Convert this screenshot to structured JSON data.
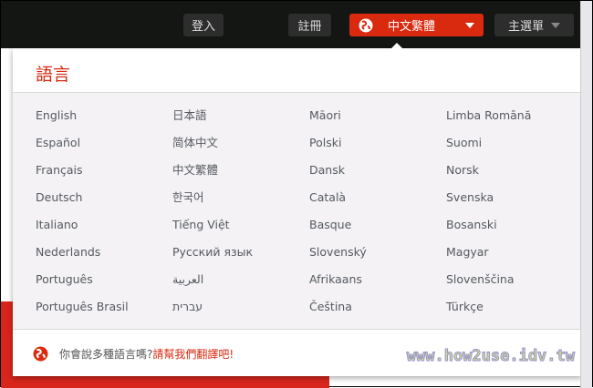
{
  "topbar": {
    "login": "登入",
    "register": "註冊",
    "language": "中文繁體",
    "menu": "主選單"
  },
  "panel": {
    "title": "語言",
    "columns": [
      [
        "English",
        "Español",
        "Français",
        "Deutsch",
        "Italiano",
        "Nederlands",
        "Português",
        "Português Brasil"
      ],
      [
        "日本語",
        "简体中文",
        "中文繁體",
        "한국어",
        "Tiếng Việt",
        "Русский язык",
        "العربية",
        "עברית"
      ],
      [
        "Māori",
        "Polski",
        "Dansk",
        "Català",
        "Basque",
        "Slovenský",
        "Afrikaans",
        "Čeština"
      ],
      [
        "Limba Română",
        "Suomi",
        "Norsk",
        "Svenska",
        "Bosanski",
        "Magyar",
        "Slovenščina",
        "Türkçe"
      ]
    ],
    "footer": {
      "question": "你會說多種語言嗎?",
      "link": "請幫我們翻譯吧!"
    }
  },
  "watermark": "www.how2use.idv.tw",
  "colors": {
    "accent": "#d92a10",
    "topbar": "#141614",
    "panel_body": "#f4f2f5"
  }
}
